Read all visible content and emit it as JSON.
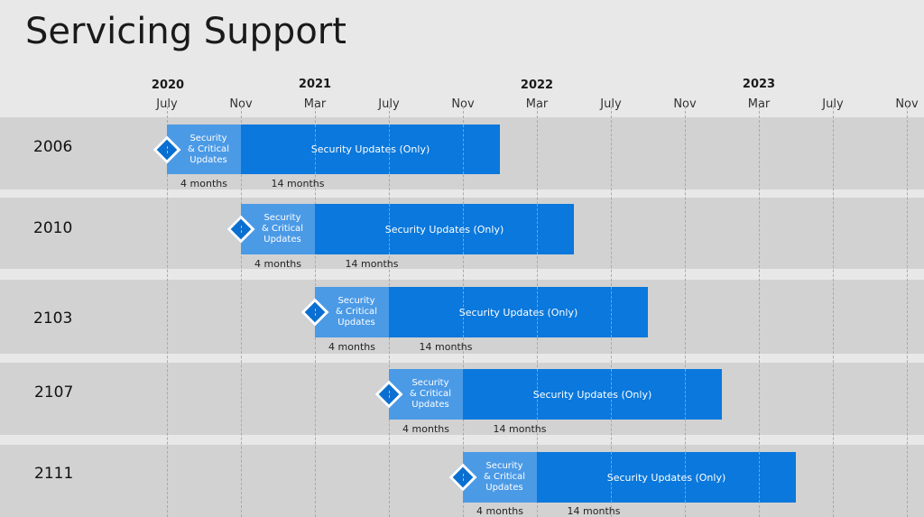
{
  "title": "Servicing Support",
  "colors": {
    "background": "#e8e8e8",
    "row_band": "#d2d2d2",
    "security_critical": "#4b9ae6",
    "security_only": "#0a78dc",
    "milestone": "#0a6fd0"
  },
  "chart_data": {
    "type": "gantt",
    "title": "Servicing Support",
    "time_unit": "month",
    "axis_start": "2020-07",
    "axis_end": "2023-11",
    "year_labels": [
      {
        "label": "2020",
        "month": "2020-07"
      },
      {
        "label": "2021",
        "month": "2021-03"
      },
      {
        "label": "2022",
        "month": "2022-03"
      },
      {
        "label": "2023",
        "month": "2023-03"
      }
    ],
    "month_ticks": [
      {
        "label": "July",
        "month": "2020-07"
      },
      {
        "label": "Nov",
        "month": "2020-11"
      },
      {
        "label": "Mar",
        "month": "2021-03"
      },
      {
        "label": "July",
        "month": "2021-07"
      },
      {
        "label": "Nov",
        "month": "2021-11"
      },
      {
        "label": "Mar",
        "month": "2022-03"
      },
      {
        "label": "July",
        "month": "2022-07"
      },
      {
        "label": "Nov",
        "month": "2022-11"
      },
      {
        "label": "Mar",
        "month": "2023-03"
      },
      {
        "label": "July",
        "month": "2023-07"
      },
      {
        "label": "Nov",
        "month": "2023-11"
      }
    ],
    "grid": true,
    "rows": [
      {
        "label": "2006",
        "start": "2020-07",
        "phases": [
          {
            "name": "Security & Critical Updates",
            "months": 4,
            "duration_label": "4 months"
          },
          {
            "name": "Security Updates (Only)",
            "months": 14,
            "duration_label": "14 months"
          }
        ]
      },
      {
        "label": "2010",
        "start": "2020-11",
        "phases": [
          {
            "name": "Security & Critical Updates",
            "months": 4,
            "duration_label": "4 months"
          },
          {
            "name": "Security Updates (Only)",
            "months": 14,
            "duration_label": "14 months"
          }
        ]
      },
      {
        "label": "2103",
        "start": "2021-03",
        "phases": [
          {
            "name": "Security & Critical Updates",
            "months": 4,
            "duration_label": "4 months"
          },
          {
            "name": "Security Updates (Only)",
            "months": 14,
            "duration_label": "14 months"
          }
        ]
      },
      {
        "label": "2107",
        "start": "2021-07",
        "phases": [
          {
            "name": "Security & Critical Updates",
            "months": 4,
            "duration_label": "4 months"
          },
          {
            "name": "Security Updates (Only)",
            "months": 14,
            "duration_label": "14 months"
          }
        ]
      },
      {
        "label": "2111",
        "start": "2021-11",
        "phases": [
          {
            "name": "Security & Critical Updates",
            "months": 4,
            "duration_label": "4 months"
          },
          {
            "name": "Security Updates (Only)",
            "months": 14,
            "duration_label": "14 months"
          }
        ]
      }
    ],
    "phase_text": {
      "security_critical_lines": [
        "Security",
        "& Critical",
        "Updates"
      ],
      "security_only": "Security Updates (Only)"
    }
  }
}
